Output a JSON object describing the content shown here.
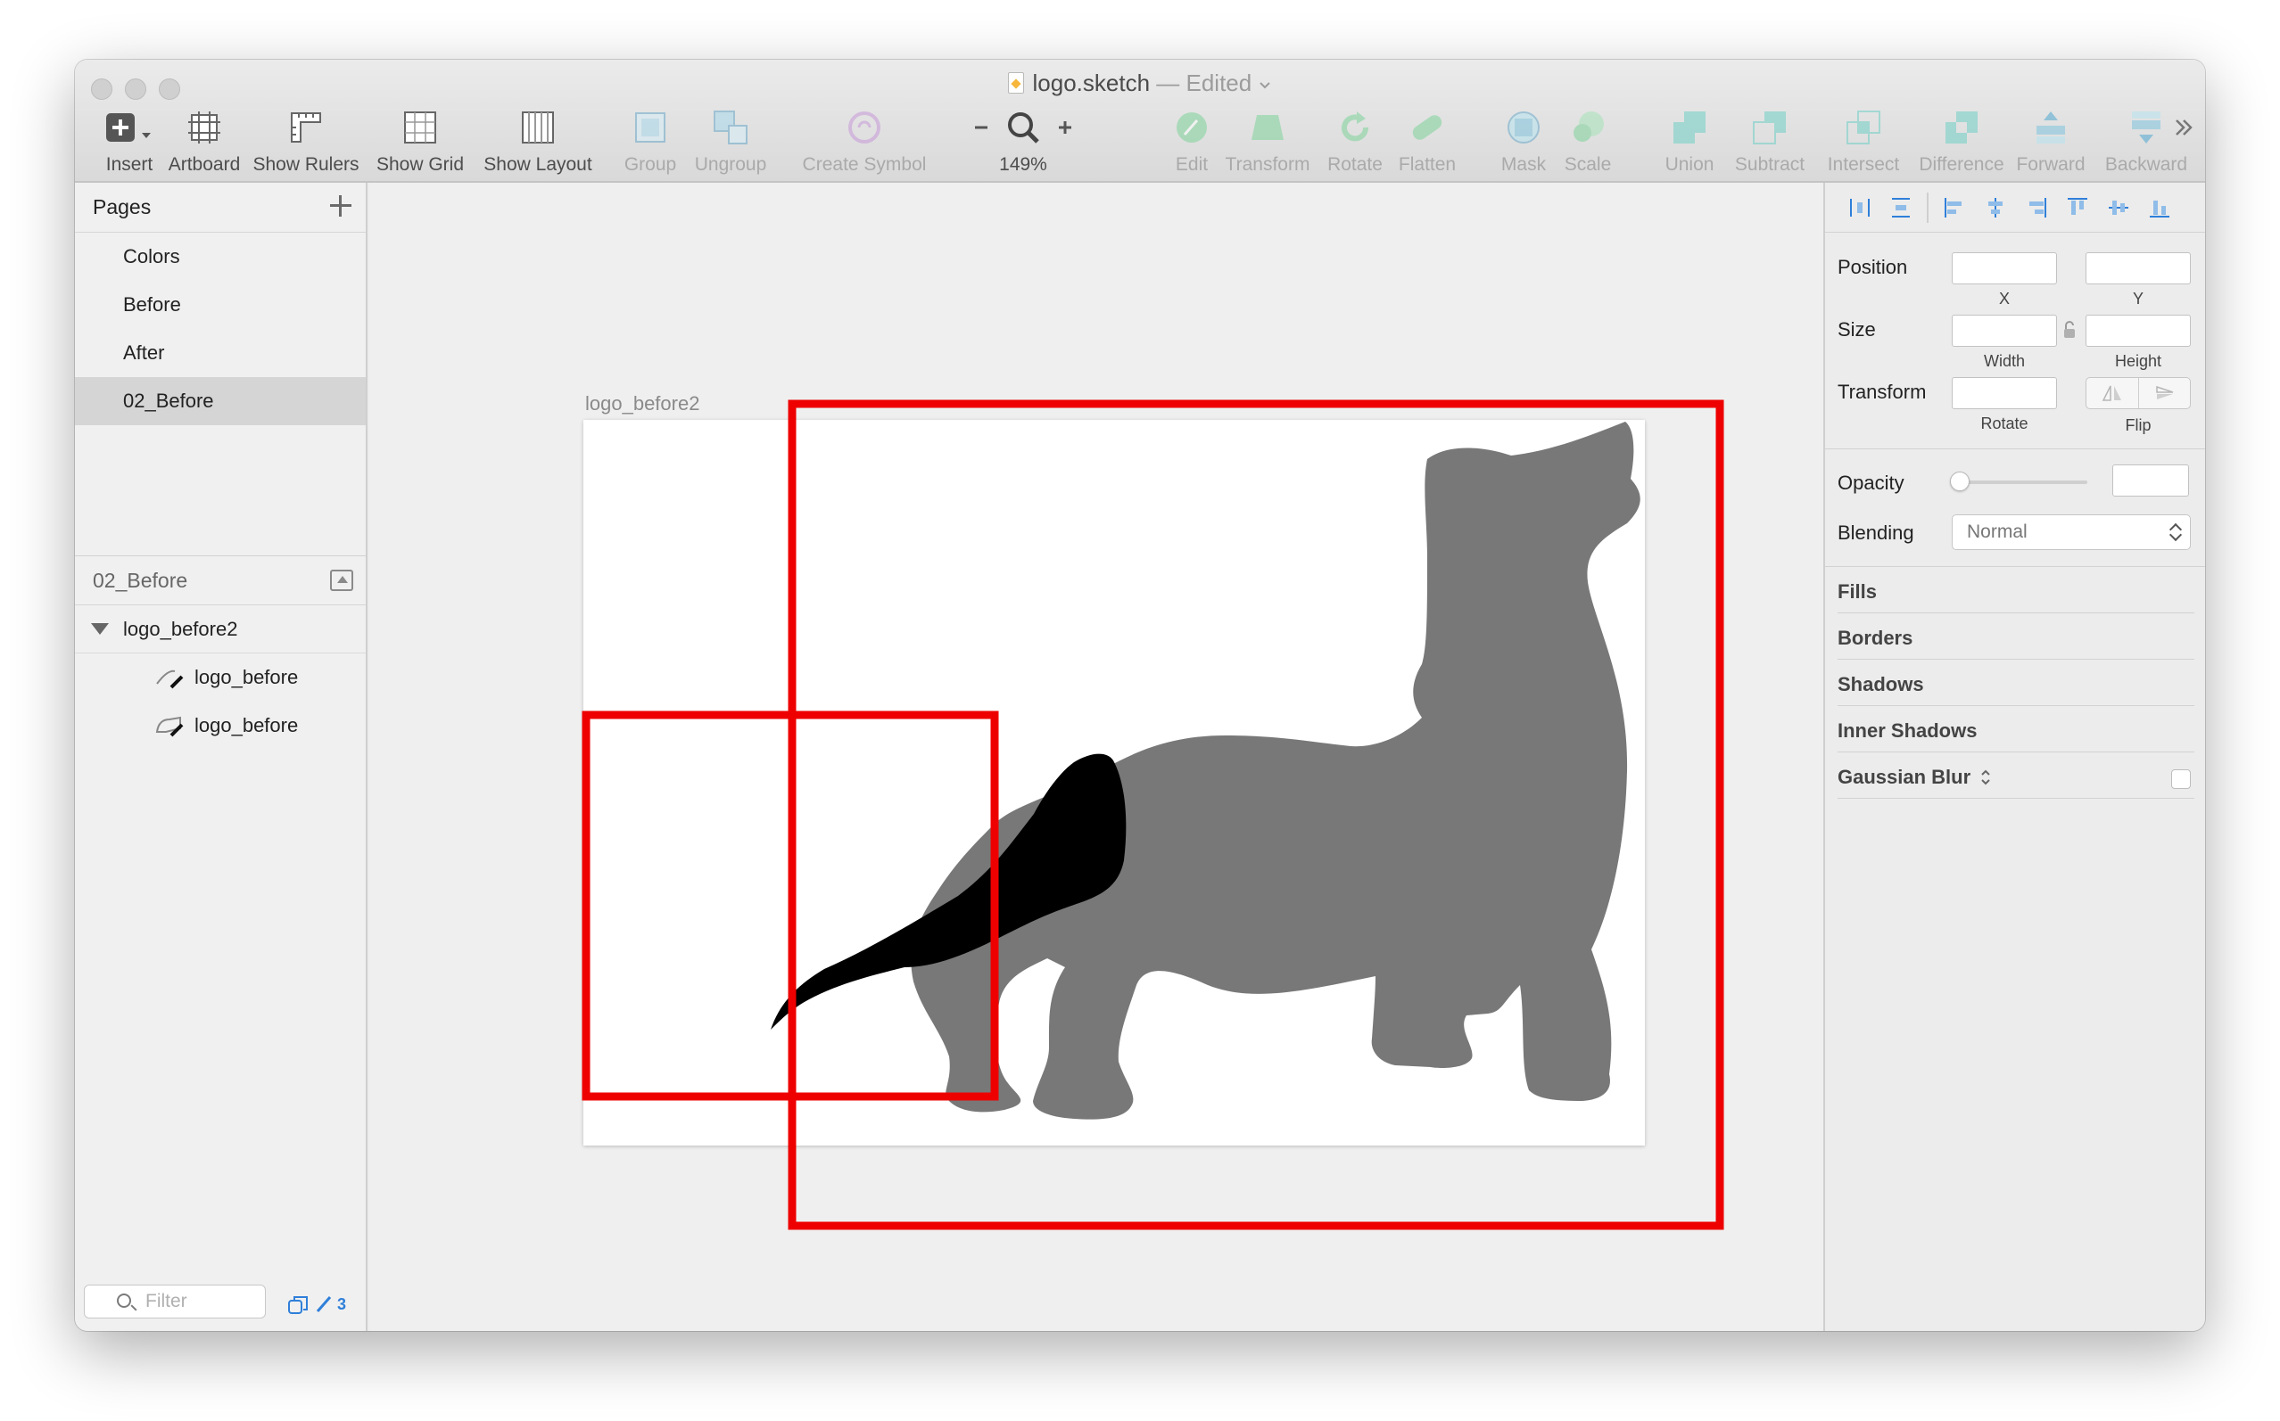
{
  "window": {
    "file_name": "logo.sketch",
    "status": "— Edited",
    "traffic_lights": [
      "close",
      "minimize",
      "zoom"
    ]
  },
  "toolbar": {
    "insert": "Insert",
    "artboard": "Artboard",
    "show_rulers": "Show Rulers",
    "show_grid": "Show Grid",
    "show_layout": "Show Layout",
    "group": "Group",
    "ungroup": "Ungroup",
    "create_symbol": "Create Symbol",
    "zoom_level": "149%",
    "edit": "Edit",
    "transform": "Transform",
    "rotate": "Rotate",
    "flatten": "Flatten",
    "mask": "Mask",
    "scale": "Scale",
    "union": "Union",
    "subtract": "Subtract",
    "intersect": "Intersect",
    "difference": "Difference",
    "forward": "Forward",
    "backward": "Backward"
  },
  "pages": {
    "header": "Pages",
    "items": [
      {
        "label": "Colors",
        "selected": false
      },
      {
        "label": "Before",
        "selected": false
      },
      {
        "label": "After",
        "selected": false
      },
      {
        "label": "02_Before",
        "selected": true
      }
    ]
  },
  "layers": {
    "header": "02_Before",
    "artboard": "logo_before2",
    "children": [
      "logo_before",
      "logo_before"
    ],
    "filter_placeholder": "Filter",
    "count": "3"
  },
  "canvas": {
    "artboard_title": "logo_before2",
    "silhouette_color": "#787878",
    "tail_color": "#000000",
    "highlight_color": "#ee0000"
  },
  "inspector": {
    "position": "Position",
    "x": "X",
    "y": "Y",
    "size": "Size",
    "width": "Width",
    "height": "Height",
    "transform": "Transform",
    "rotate": "Rotate",
    "flip": "Flip",
    "opacity": "Opacity",
    "blending": "Blending",
    "blending_value": "Normal",
    "fills": "Fills",
    "borders": "Borders",
    "shadows": "Shadows",
    "inner_shadows": "Inner Shadows",
    "gaussian_blur": "Gaussian Blur"
  },
  "colors": {
    "accent_blue": "#2f7fd9",
    "toolbar_icon_teal": "#6fcfc6",
    "toolbar_icon_green": "#7ed39a"
  }
}
